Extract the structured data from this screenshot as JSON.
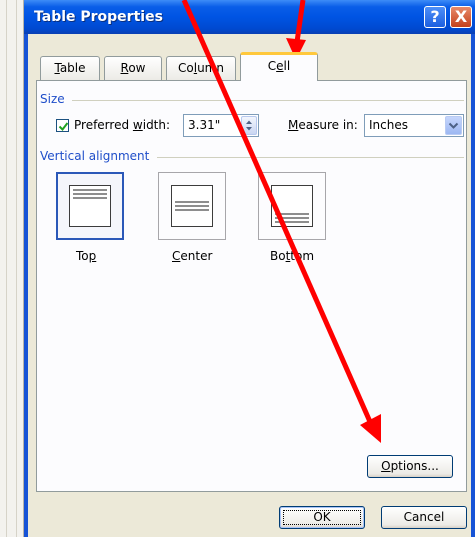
{
  "dialog": {
    "title": "Table Properties",
    "help_label": "?",
    "close_label": "X"
  },
  "tabs": [
    {
      "pre": "",
      "u": "T",
      "post": "able",
      "active": false
    },
    {
      "pre": "",
      "u": "R",
      "post": "ow",
      "active": false
    },
    {
      "pre": "Co",
      "u": "l",
      "post": "umn",
      "active": false
    },
    {
      "pre": "C",
      "u": "e",
      "post": "ll",
      "active": true
    }
  ],
  "size": {
    "group_label": "Size",
    "preferred_width": {
      "pre": "Preferred ",
      "u": "w",
      "post": "idth:",
      "checked": true
    },
    "width_value": "3.31\"",
    "measure_in": {
      "pre": "",
      "u": "M",
      "post": "easure in:"
    },
    "measure_value": "Inches"
  },
  "vertical_alignment": {
    "group_label": "Vertical alignment",
    "options": [
      {
        "pre": "To",
        "u": "p",
        "post": "",
        "selected": true
      },
      {
        "pre": "",
        "u": "C",
        "post": "enter",
        "selected": false
      },
      {
        "pre": "Bo",
        "u": "t",
        "post": "tom",
        "selected": false
      }
    ]
  },
  "buttons": {
    "options": {
      "pre": "",
      "u": "O",
      "post": "ptions..."
    },
    "ok": "OK",
    "cancel": "Cancel"
  },
  "colors": {
    "title_bar": "#0054e3",
    "annotation_arrow": "#ff0000",
    "active_tab_highlight": "#ffc83c"
  }
}
